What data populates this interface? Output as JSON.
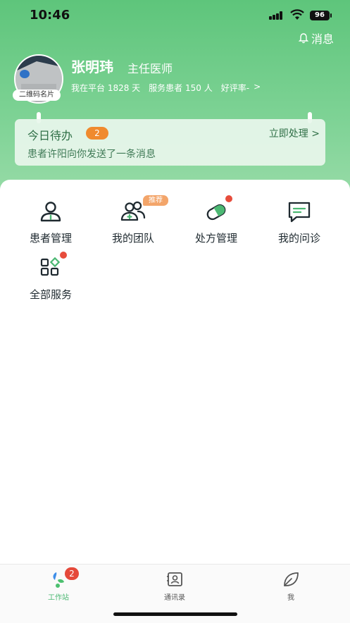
{
  "status_bar": {
    "time": "10:46",
    "battery": "96"
  },
  "header": {
    "message_label": "消息",
    "qr_label": "二维码名片",
    "doctor_name": "张明玮",
    "doctor_title": "主任医师",
    "stat_days": "我在平台 1828 天",
    "stat_patients": "服务患者 150 人",
    "stat_rating": "好评率-",
    "stat_chevron": ">"
  },
  "todo": {
    "title": "今日待办",
    "count": "2",
    "action": "立即处理 >",
    "message": "患者许阳向你发送了一条消息"
  },
  "services": [
    {
      "label": "患者管理",
      "icon": "patient-icon"
    },
    {
      "label": "我的团队",
      "icon": "team-icon",
      "tag": "推荐"
    },
    {
      "label": "处方管理",
      "icon": "pill-icon"
    },
    {
      "label": "我的问诊",
      "icon": "chat-icon"
    },
    {
      "label": "全部服务",
      "icon": "grid-icon"
    }
  ],
  "tabbar": {
    "items": [
      {
        "label": "工作站",
        "icon": "workstation-icon",
        "badge": "2"
      },
      {
        "label": "通讯录",
        "icon": "contacts-icon"
      },
      {
        "label": "我",
        "icon": "leaf-icon"
      }
    ]
  },
  "colors": {
    "brand": "#5ec57b",
    "badge": "#f08a2e",
    "alert": "#e74c3c"
  }
}
